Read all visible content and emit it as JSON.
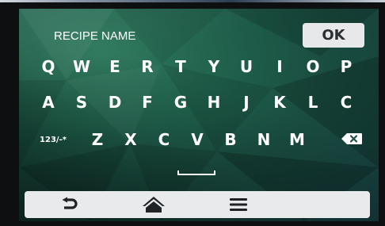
{
  "header": {
    "field_label": "RECIPE NAME",
    "ok_label": "OK"
  },
  "keyboard": {
    "row1": [
      "Q",
      "W",
      "E",
      "R",
      "T",
      "Y",
      "U",
      "I",
      "O",
      "P"
    ],
    "row2": [
      "A",
      "S",
      "D",
      "F",
      "G",
      "H",
      "J",
      "K",
      "L",
      "C"
    ],
    "row3": [
      "Z",
      "X",
      "C",
      "V",
      "B",
      "N",
      "M"
    ],
    "symbols_label": "123/-*",
    "space_icon": "spacebar-icon",
    "backspace_icon": "backspace-icon"
  },
  "nav": {
    "back_icon": "back-arrow-icon",
    "home_icon": "home-icon",
    "menu_icon": "menu-icon"
  },
  "colors": {
    "background": "#1d5a48",
    "key_text": "#ffffff",
    "ok_bg": "#e6e8ea",
    "nav_bg": "#e8eaec",
    "icon_dark": "#1f2326"
  }
}
